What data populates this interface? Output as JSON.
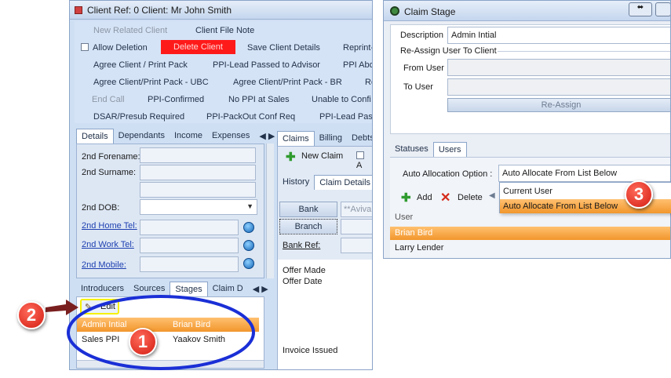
{
  "left_window": {
    "title": "Client Ref: 0 Client: Mr John Smith",
    "toolbar": {
      "new_related_client": "New Related Client",
      "client_file_note": "Client File Note",
      "allow_deletion": "Allow Deletion",
      "delete_client": "Delete Client",
      "save_client_details": "Save Client Details",
      "reprint": "Reprint-",
      "agree_client_print_pack": "Agree Client / Print Pack",
      "ppi_lead_passed_advisor": "PPI-Lead Passed to Advisor",
      "ppi_abo": "PPI Abo",
      "agree_pack_ubc": "Agree Client/Print Pack - UBC",
      "agree_pack_br": "Agree Client/Print Pack - BR",
      "re": "Re",
      "end_call": "End Call",
      "ppi_confirmed": "PPI-Confirmed",
      "no_ppi_at_sales": "No PPI at Sales",
      "unable_to_confi": "Unable to Confi",
      "dsar_presub": "DSAR/Presub Required",
      "ppi_packout": "PPI-PackOut Conf Req",
      "ppi_lead_passe": "PPI-Lead Passe"
    },
    "detail_tabs": [
      "Details",
      "Dependants",
      "Income",
      "Expenses"
    ],
    "fields": {
      "second_forename": "2nd Forename:",
      "second_surname": "2nd Surname:",
      "second_dob": "2nd DOB:",
      "second_home_tel": "2nd Home Tel:",
      "second_work_tel": "2nd Work Tel:",
      "second_mobile": "2nd Mobile:"
    },
    "bottom_tabs": [
      "Introducers",
      "Sources",
      "Stages",
      "Claim D"
    ],
    "edit_label": "Edit",
    "stage_rows": [
      {
        "stage": "Admin Intial",
        "user": "Brian Bird"
      },
      {
        "stage": "Sales PPI",
        "user": "Yaakov Smith"
      }
    ],
    "claim_tabs": [
      "Claims",
      "Billing",
      "Debts"
    ],
    "new_claim": "New Claim",
    "claim_checkbox_label": "A",
    "history_tabs": [
      "History",
      "Claim Details"
    ],
    "bank_label": "Bank",
    "bank_value": "**Aviva",
    "branch_label": "Branch",
    "bank_ref_label": "Bank Ref:",
    "offer_made": "Offer Made",
    "offer_date": "Offer Date",
    "invoice_issued": "Invoice Issued"
  },
  "right_window": {
    "title": "Claim Stage",
    "description_label": "Description",
    "description_value": "Admin Intial",
    "reassign_group": "Re-Assign User To Client",
    "from_user_label": "From User",
    "to_user_label": "To User",
    "reassign_button": "Re-Assign",
    "tabs": [
      "Statuses",
      "Users"
    ],
    "auto_alloc_label": "Auto Allocation Option :",
    "auto_alloc_value": "Auto Allocate From List Below",
    "add_label": "Add",
    "delete_label": "Delete",
    "user_column": "User",
    "users": [
      "Brian Bird",
      "Larry Lender"
    ],
    "dropdown_options": [
      "Current User",
      "Auto Allocate From List Below"
    ]
  },
  "callouts": [
    "1",
    "2",
    "3"
  ],
  "colors": {
    "selection": "#f2962c",
    "delete_red": "#ff1a1a",
    "callout": "#d31d12",
    "highlight_oval": "#1a2fd6",
    "edit_highlight": "#f5f000"
  }
}
